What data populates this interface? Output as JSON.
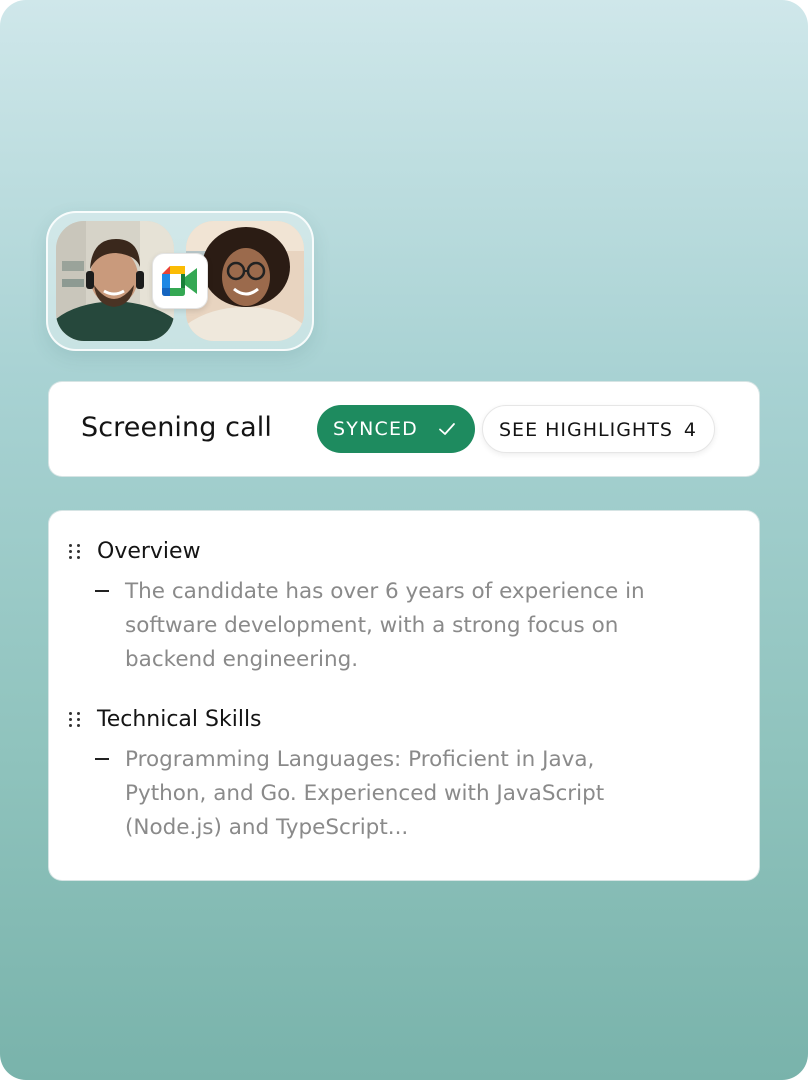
{
  "call": {
    "title": "Screening call",
    "synced_label": "SYNCED",
    "highlights_label": "SEE HIGHLIGHTS",
    "highlights_count": "4",
    "meeting_app_icon": "google-meet-icon"
  },
  "participants": [
    {
      "avatar": "participant-man-headset"
    },
    {
      "avatar": "participant-woman-glasses"
    }
  ],
  "notes": {
    "sections": [
      {
        "title": "Overview",
        "bullets": [
          "The candidate has over 6 years of experience in software development, with a strong focus on backend engineering."
        ]
      },
      {
        "title": "Technical Skills",
        "bullets": [
          "Programming Languages: Proficient in Java, Python, and Go. Experienced with JavaScript (Node.js) and TypeScript..."
        ]
      }
    ]
  },
  "colors": {
    "synced_green": "#1e8b5f",
    "background_top": "#cfe7ea",
    "background_bottom": "#79b3ab"
  }
}
